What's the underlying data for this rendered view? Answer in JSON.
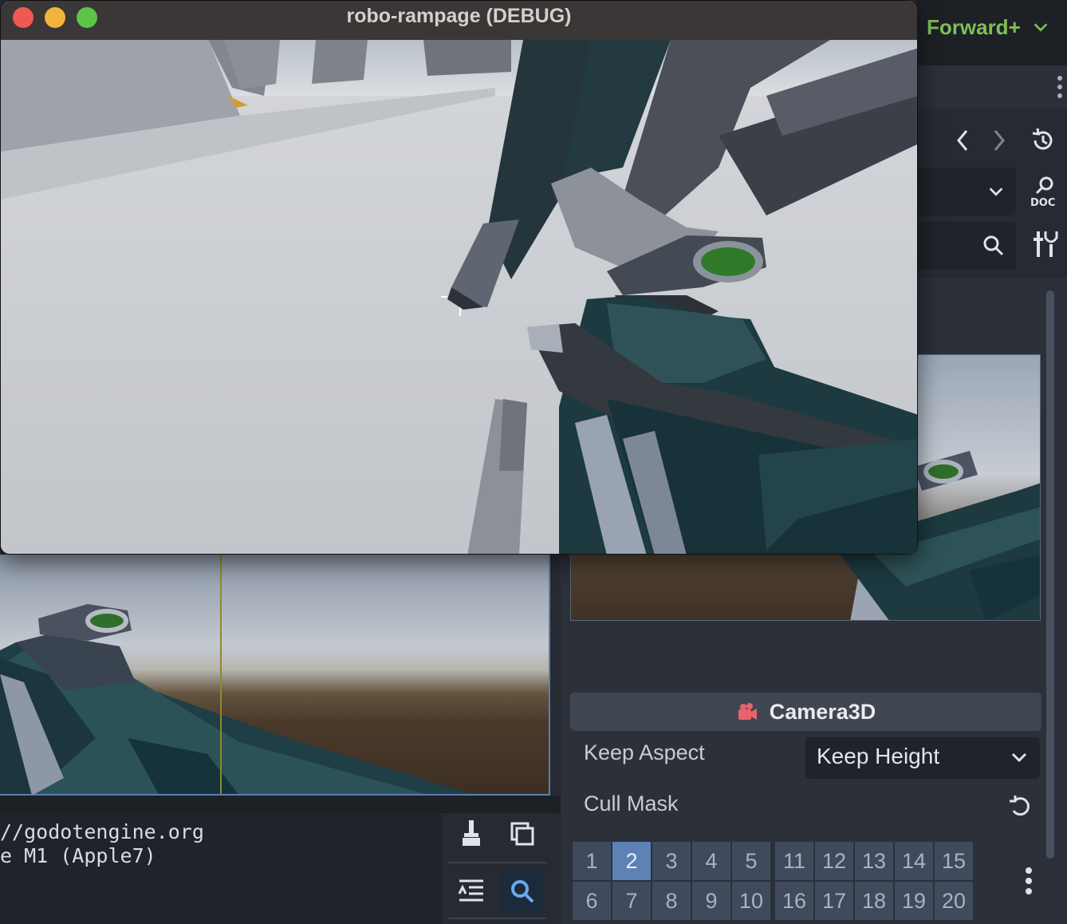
{
  "editor": {
    "renderer": "Forward+",
    "inspector": {
      "section_title": "Camera3D",
      "keep_aspect": {
        "label": "Keep Aspect",
        "value": "Keep Height"
      },
      "cull_mask": {
        "label": "Cull Mask",
        "row1": [
          "1",
          "2",
          "3",
          "4",
          "5",
          "11",
          "12",
          "13",
          "14",
          "15"
        ],
        "row2": [
          "6",
          "7",
          "8",
          "9",
          "10",
          "16",
          "17",
          "18",
          "19",
          "20"
        ],
        "enabled_layers": [
          "2"
        ]
      }
    },
    "output": {
      "lines": [
        "//godotengine.org",
        "e M1 (Apple7)"
      ]
    }
  },
  "game_window": {
    "title": "robo-rampage (DEBUG)"
  },
  "colors": {
    "renderer_accent": "#7fbf57",
    "camera_icon": "#e8646a",
    "layer_enabled": "#5e82b5",
    "layer_disabled": "#3f4b5d",
    "viewport_border": "#5b7fb0"
  },
  "icons": [
    "chevron-down-icon",
    "kebab-menu-icon",
    "back-icon",
    "forward-icon",
    "history-icon",
    "doc-search-icon",
    "search-icon",
    "tools-icon",
    "camera-icon",
    "revert-icon",
    "broom-icon",
    "copy-icon",
    "collapse-icon",
    "filter-search-icon"
  ]
}
